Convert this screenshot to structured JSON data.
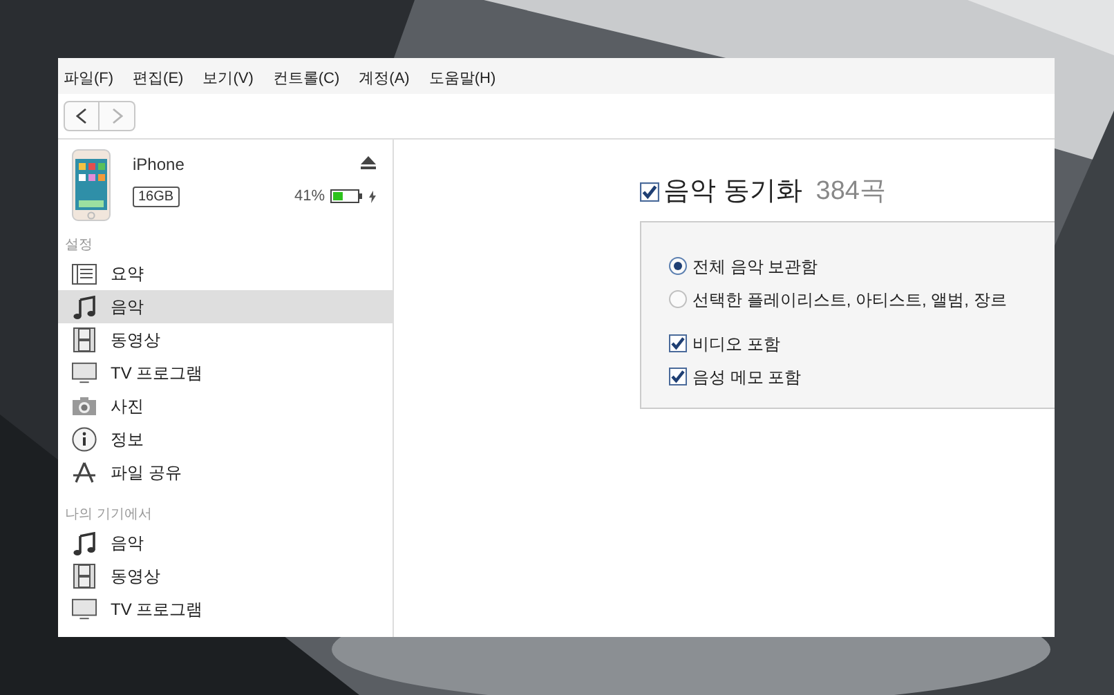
{
  "menu": [
    "파일(F)",
    "편집(E)",
    "보기(V)",
    "컨트롤(C)",
    "계정(A)",
    "도움말(H)"
  ],
  "nav": [
    {
      "kind": "back",
      "disabled": false
    },
    {
      "kind": "forward",
      "disabled": true
    }
  ],
  "device": {
    "name": "iPhone",
    "capacity": "16GB",
    "battery": "41%",
    "level": 0.41,
    "charging": true
  },
  "sections": [
    {
      "header": "설정",
      "items": [
        {
          "label": "요약",
          "kind": "list",
          "selected": false
        },
        {
          "label": "음악",
          "kind": "music",
          "selected": true
        },
        {
          "label": "동영상",
          "kind": "film",
          "selected": false
        },
        {
          "label": "TV 프로그램",
          "kind": "tv",
          "selected": false
        },
        {
          "label": "사진",
          "kind": "camera",
          "selected": false
        },
        {
          "label": "정보",
          "kind": "info",
          "selected": false
        },
        {
          "label": "파일 공유",
          "kind": "apps",
          "selected": false
        }
      ]
    },
    {
      "header": "나의 기기에서",
      "items": [
        {
          "label": "음악",
          "kind": "music",
          "selected": false
        },
        {
          "label": "동영상",
          "kind": "film",
          "selected": false
        },
        {
          "label": "TV 프로그램",
          "kind": "tv",
          "selected": false
        }
      ]
    }
  ],
  "sync": {
    "label": "음악 동기화",
    "count": "384곡",
    "checked": true
  },
  "options": [
    {
      "label": "전체 음악 보관함",
      "kind": "radio",
      "selected": true
    },
    {
      "label": "선택한 플레이리스트, 아티스트, 앨범, 장르",
      "kind": "radio",
      "selected": false
    },
    {
      "label": "비디오 포함",
      "kind": "checkbox",
      "checked": true
    },
    {
      "label": "음성 메모 포함",
      "kind": "checkbox",
      "checked": true
    }
  ]
}
